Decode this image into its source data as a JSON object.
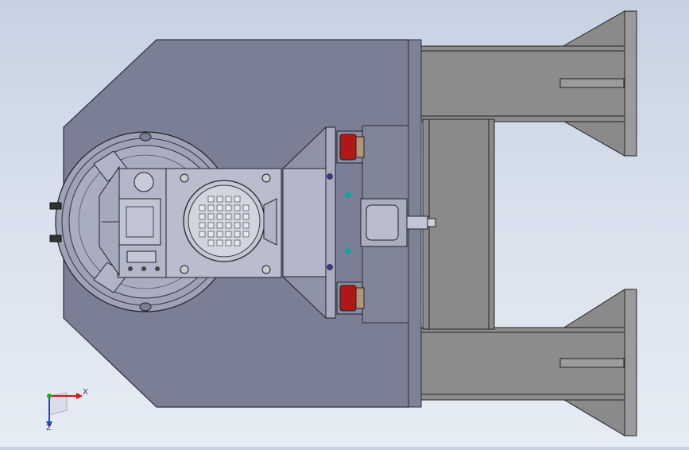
{
  "viewport": {
    "background_top": "#c6d2e2",
    "background_bottom": "#e6ecf4"
  },
  "colors": {
    "body_plate": "#7b7f95",
    "plate_edge": "#2f3040",
    "frame_steel": "#888888",
    "frame_dark": "#5f5f5f",
    "turntable": "#a7abc0",
    "bracket": "#b3b7c9",
    "motor_body": "#bfc3d3",
    "brake_red": "#b01818",
    "brake_tan": "#b5947a",
    "axis_x": "#e01010",
    "axis_y": "#13b813",
    "axis_z": "#2040d0"
  },
  "triad": {
    "x_label": "X",
    "z_label": "Z"
  },
  "components": {
    "motor_fan_grid_rows": 6,
    "motor_fan_grid_cols": 6
  }
}
